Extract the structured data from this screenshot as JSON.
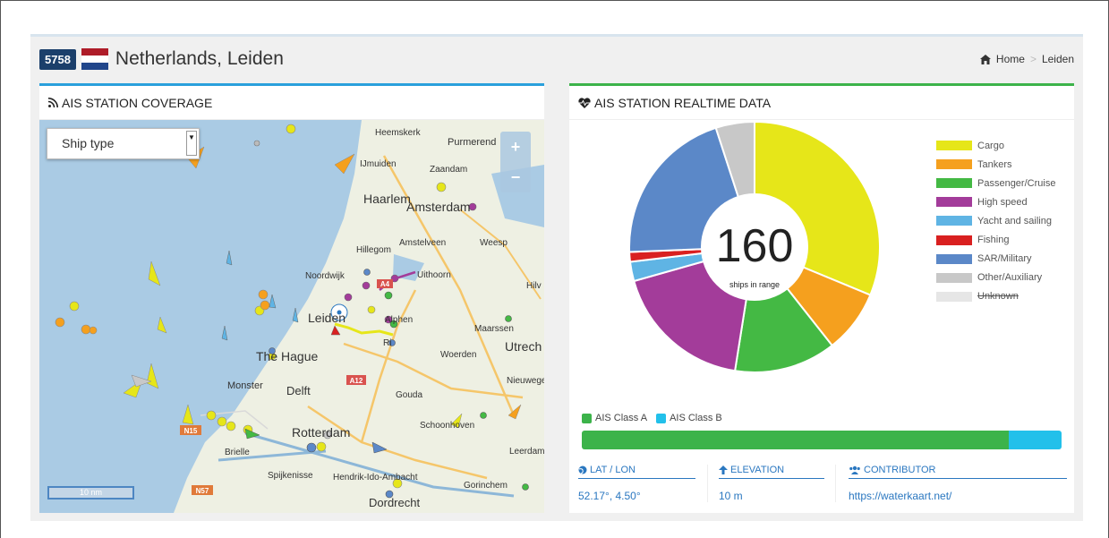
{
  "header": {
    "station_id": "5758",
    "title": "Netherlands, Leiden",
    "flag_colors": [
      "#ae1c28",
      "#ffffff",
      "#21468b"
    ],
    "breadcrumb": {
      "home_label": "Home",
      "separator": ">",
      "current": "Leiden"
    }
  },
  "coverage_panel": {
    "title": "AIS STATION COVERAGE",
    "ship_type_select": "Ship type",
    "zoom_in": "+",
    "zoom_out": "−",
    "scale_label": "10 nm",
    "map_labels": [
      "Heemskerk",
      "Purmerend",
      "IJmuiden",
      "Zaandam",
      "Haarlem",
      "Amsterdam",
      "Hillegom",
      "Amstelveen",
      "Weesp",
      "Noordwijk",
      "Uithoorn",
      "Hilv",
      "Leiden",
      "Alphen",
      "Maarssen",
      "Utrech",
      "The Hague",
      "Woerden",
      "A12",
      "Nieuwegei",
      "Monster",
      "Delft",
      "Gouda",
      "Schoonhoven",
      "N15",
      "Brielle",
      "Rotterdam",
      "Leerdam",
      "Spijkenisse",
      "Hendrik-Ido-Ambacht",
      "Gorinchem",
      "N57",
      "Dordrecht",
      "A4",
      "Ri"
    ]
  },
  "realtime_panel": {
    "title": "AIS STATION REALTIME DATA",
    "center_count": "160",
    "center_caption": "ships in range",
    "class_legend": [
      {
        "label": "AIS Class A",
        "color": "#3cb34a"
      },
      {
        "label": "AIS Class B",
        "color": "#22c0ea"
      }
    ],
    "class_bar": {
      "class_a_fraction": 0.89,
      "class_b_fraction": 0.11
    },
    "stats": [
      {
        "icon": "globe-icon",
        "label": "LAT / LON",
        "value": "52.17°, 4.50°"
      },
      {
        "icon": "arrow-up-icon",
        "label": "ELEVATION",
        "value": "10 m"
      },
      {
        "icon": "users-icon",
        "label": "CONTRIBUTOR",
        "value": "https://waterkaart.net/"
      }
    ]
  },
  "chart_data": {
    "type": "pie",
    "title": "",
    "donut": true,
    "total": 160,
    "legend_position": "right",
    "series": [
      {
        "name": "Cargo",
        "value": 50,
        "color": "#e6e619"
      },
      {
        "name": "Tankers",
        "value": 13,
        "color": "#f5a01e"
      },
      {
        "name": "Passenger/Cruise",
        "value": 21,
        "color": "#44b944"
      },
      {
        "name": "High speed",
        "value": 29,
        "color": "#a33c9a"
      },
      {
        "name": "Yacht and sailing",
        "value": 4,
        "color": "#5fb4e4"
      },
      {
        "name": "Fishing",
        "value": 2,
        "color": "#d92020"
      },
      {
        "name": "SAR/Military",
        "value": 33,
        "color": "#5b88c8"
      },
      {
        "name": "Other/Auxiliary",
        "value": 8,
        "color": "#c8c8c8"
      },
      {
        "name": "Unknown",
        "value": 0,
        "color": "#e6e6e6",
        "hidden": true
      }
    ]
  }
}
